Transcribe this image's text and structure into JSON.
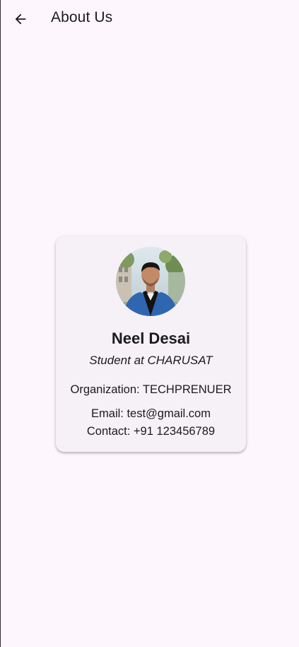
{
  "appbar": {
    "title": "About Us",
    "back_icon": "arrow-left-icon"
  },
  "profile": {
    "avatar": "profile-photo",
    "name": "Neel Desai",
    "role": "Student at CHARUSAT",
    "organization": "Organization: TECHPRENUER",
    "email": "Email: test@gmail.com",
    "contact": "Contact: +91 123456789"
  },
  "colors": {
    "background": "#fdf7fd",
    "card": "#f5f1f6",
    "text": "#1c1b1f"
  }
}
